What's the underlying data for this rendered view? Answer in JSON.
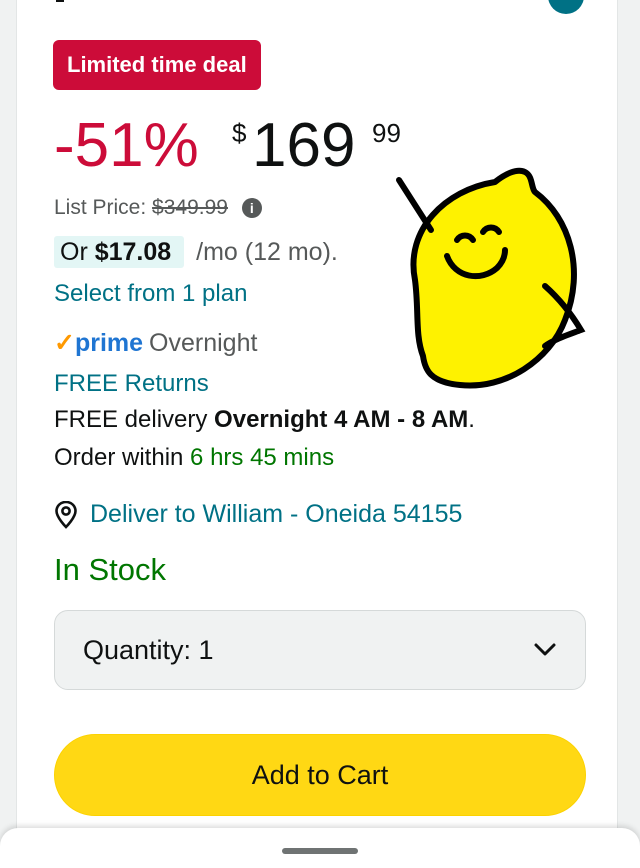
{
  "deal": {
    "badge": "Limited time deal"
  },
  "price": {
    "discount": "-51%",
    "currency": "$",
    "whole": "169",
    "fraction": "99",
    "list_label": "List Price:",
    "list_value": "$349.99",
    "info_icon": "i"
  },
  "monthly": {
    "prefix": "Or ",
    "amount": "$17.08",
    "suffix": "/mo (12 mo).",
    "select_plan": "Select from 1 plan"
  },
  "shipping": {
    "check": "✓",
    "prime": "prime",
    "overnight": "Overnight",
    "free_returns": "FREE Returns",
    "free_delivery_prefix": "FREE delivery ",
    "free_delivery_window": "Overnight 4 AM - 8 AM",
    "free_delivery_suffix": ".",
    "order_within_prefix": "Order within ",
    "order_within_time": "6 hrs 45 mins"
  },
  "location": {
    "deliver_to": "Deliver to William - Oneida 54155"
  },
  "stock": {
    "status": "In Stock"
  },
  "quantity": {
    "label": "Quantity: 1"
  },
  "cart": {
    "button_label": "Add to Cart"
  },
  "colors": {
    "deal_red": "#cc0c39",
    "link_teal": "#007185",
    "stock_green": "#007600",
    "cart_yellow": "#ffd814",
    "prime_blue": "#1f75d2",
    "prime_orange": "#ff9900"
  },
  "icons": [
    "info-icon",
    "location-pin-icon",
    "chevron-down-icon",
    "prime-check-icon",
    "lemon-sticker-icon"
  ]
}
